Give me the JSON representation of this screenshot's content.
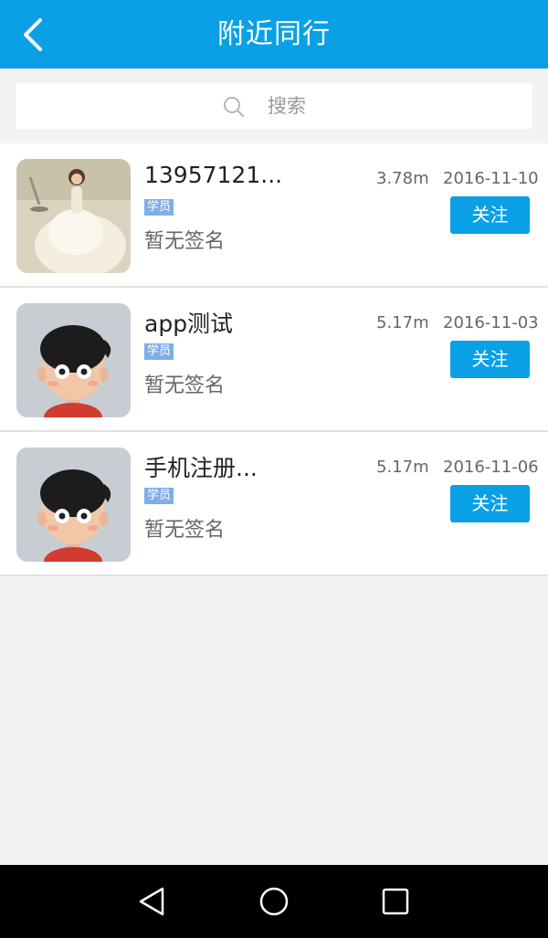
{
  "header": {
    "title": "附近同行",
    "back_icon": "chevron-left-icon",
    "background": "#0aa0e6"
  },
  "search": {
    "icon": "search-icon",
    "placeholder": "搜索"
  },
  "items": [
    {
      "name": "13957121...",
      "badge": "学员",
      "signature": "暂无签名",
      "distance": "3.78m",
      "date": "2016-11-10",
      "follow_label": "关注",
      "avatar": "avatar-photo-doll"
    },
    {
      "name": "app测试",
      "badge": "学员",
      "signature": "暂无签名",
      "distance": "5.17m",
      "date": "2016-11-03",
      "follow_label": "关注",
      "avatar": "avatar-cartoon-boy"
    },
    {
      "name": "手机注册...",
      "badge": "学员",
      "signature": "暂无签名",
      "distance": "5.17m",
      "date": "2016-11-06",
      "follow_label": "关注",
      "avatar": "avatar-cartoon-boy"
    }
  ],
  "nav_bar": {
    "back": "triangle-back-icon",
    "home": "circle-home-icon",
    "recents": "square-recents-icon"
  },
  "colors": {
    "accent": "#0aa0e6",
    "badge": "#7faee8"
  }
}
